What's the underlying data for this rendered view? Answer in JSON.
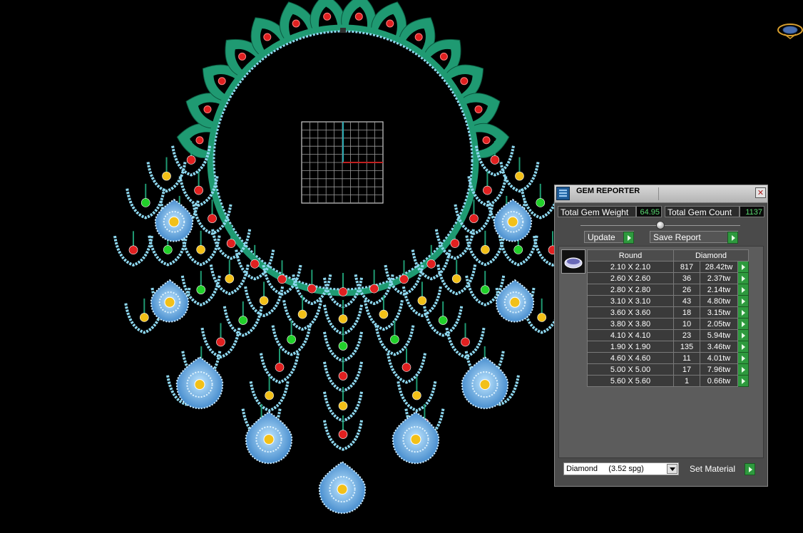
{
  "gem_reporter": {
    "title": "GEM REPORTER",
    "close_icon": "close-icon",
    "total_gem_weight_label": "Total Gem Weight",
    "total_gem_weight_value": "64.95",
    "total_gem_count_label": "Total Gem Count",
    "total_gem_count_value": "1137",
    "update_label": "Update",
    "save_report_label": "Save Report",
    "table_headers": [
      "Round",
      "Diamond"
    ],
    "rows": [
      {
        "size": "2.10 X 2.10",
        "count": "817",
        "weight": "28.42tw"
      },
      {
        "size": "2.60 X 2.60",
        "count": "36",
        "weight": "2.37tw"
      },
      {
        "size": "2.80 X 2.80",
        "count": "26",
        "weight": "2.14tw"
      },
      {
        "size": "3.10 X 3.10",
        "count": "43",
        "weight": "4.80tw"
      },
      {
        "size": "3.60 X 3.60",
        "count": "18",
        "weight": "3.15tw"
      },
      {
        "size": "3.80 X 3.80",
        "count": "10",
        "weight": "2.05tw"
      },
      {
        "size": "4.10 X 4.10",
        "count": "23",
        "weight": "5.94tw"
      },
      {
        "size": "1.90 X 1.90",
        "count": "135",
        "weight": "3.46tw"
      },
      {
        "size": "4.60 X 4.60",
        "count": "11",
        "weight": "4.01tw"
      },
      {
        "size": "5.00 X 5.00",
        "count": "17",
        "weight": "7.96tw"
      },
      {
        "size": "5.60 X 5.60",
        "count": "1",
        "weight": "0.66tw"
      }
    ],
    "material_value": "Diamond     (3.52 spg)",
    "set_material_label": "Set Material"
  },
  "colors": {
    "background": "#000000",
    "metal_green": "#1f9a72",
    "diamond_blue": "#8ed8f0",
    "ruby_red": "#e02020",
    "emerald_green": "#22d02a",
    "citrine_yellow": "#f2c018",
    "pave_blue": "#8cc4ee",
    "accent_green": "#2e9a3e"
  }
}
